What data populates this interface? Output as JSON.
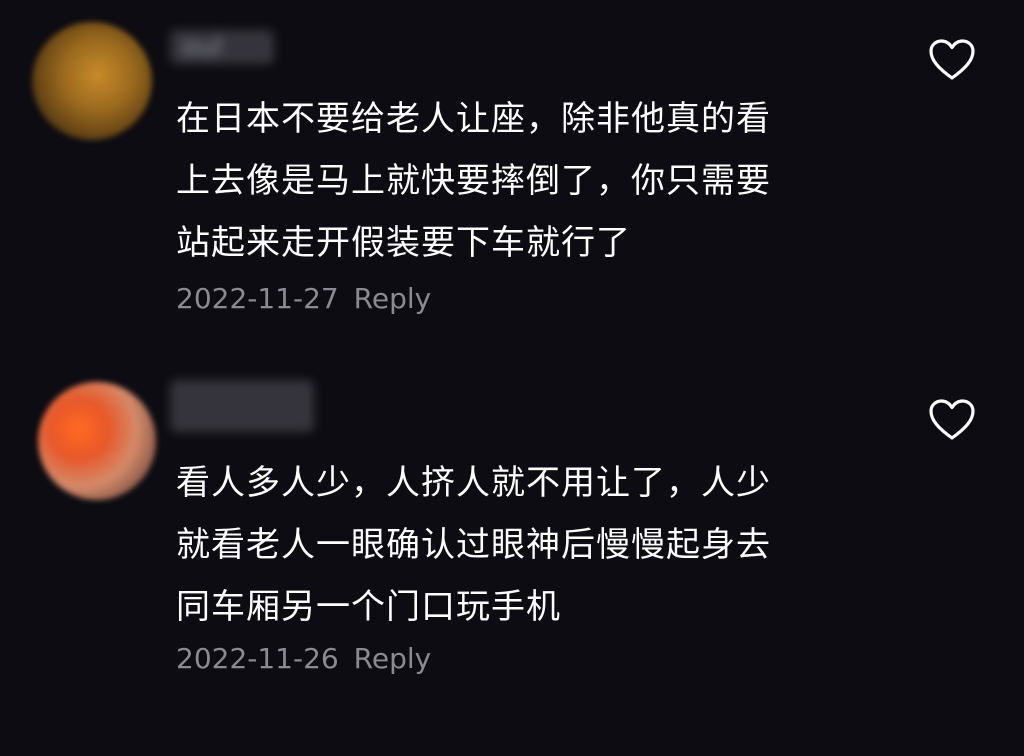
{
  "comments": [
    {
      "username": "oul",
      "lines": [
        "在日本不要给老人让座，除非他真的看",
        "上去像是马上就快要摔倒了，你只需要",
        "站起来走开假装要下车就行了"
      ],
      "date": "2022-11-27",
      "reply_label": "Reply",
      "like_icon": "heart-outline-icon"
    },
    {
      "username": "",
      "lines": [
        "看人多人少，人挤人就不用让了，人少",
        "就看老人一眼确认过眼神后慢慢起身去",
        "同车厢另一个门口玩手机"
      ],
      "date": "2022-11-26",
      "reply_label": "Reply",
      "like_icon": "heart-outline-icon"
    }
  ],
  "colors": {
    "background": "#0d0c12",
    "text": "#ffffff",
    "secondary": "#8b8a93"
  }
}
